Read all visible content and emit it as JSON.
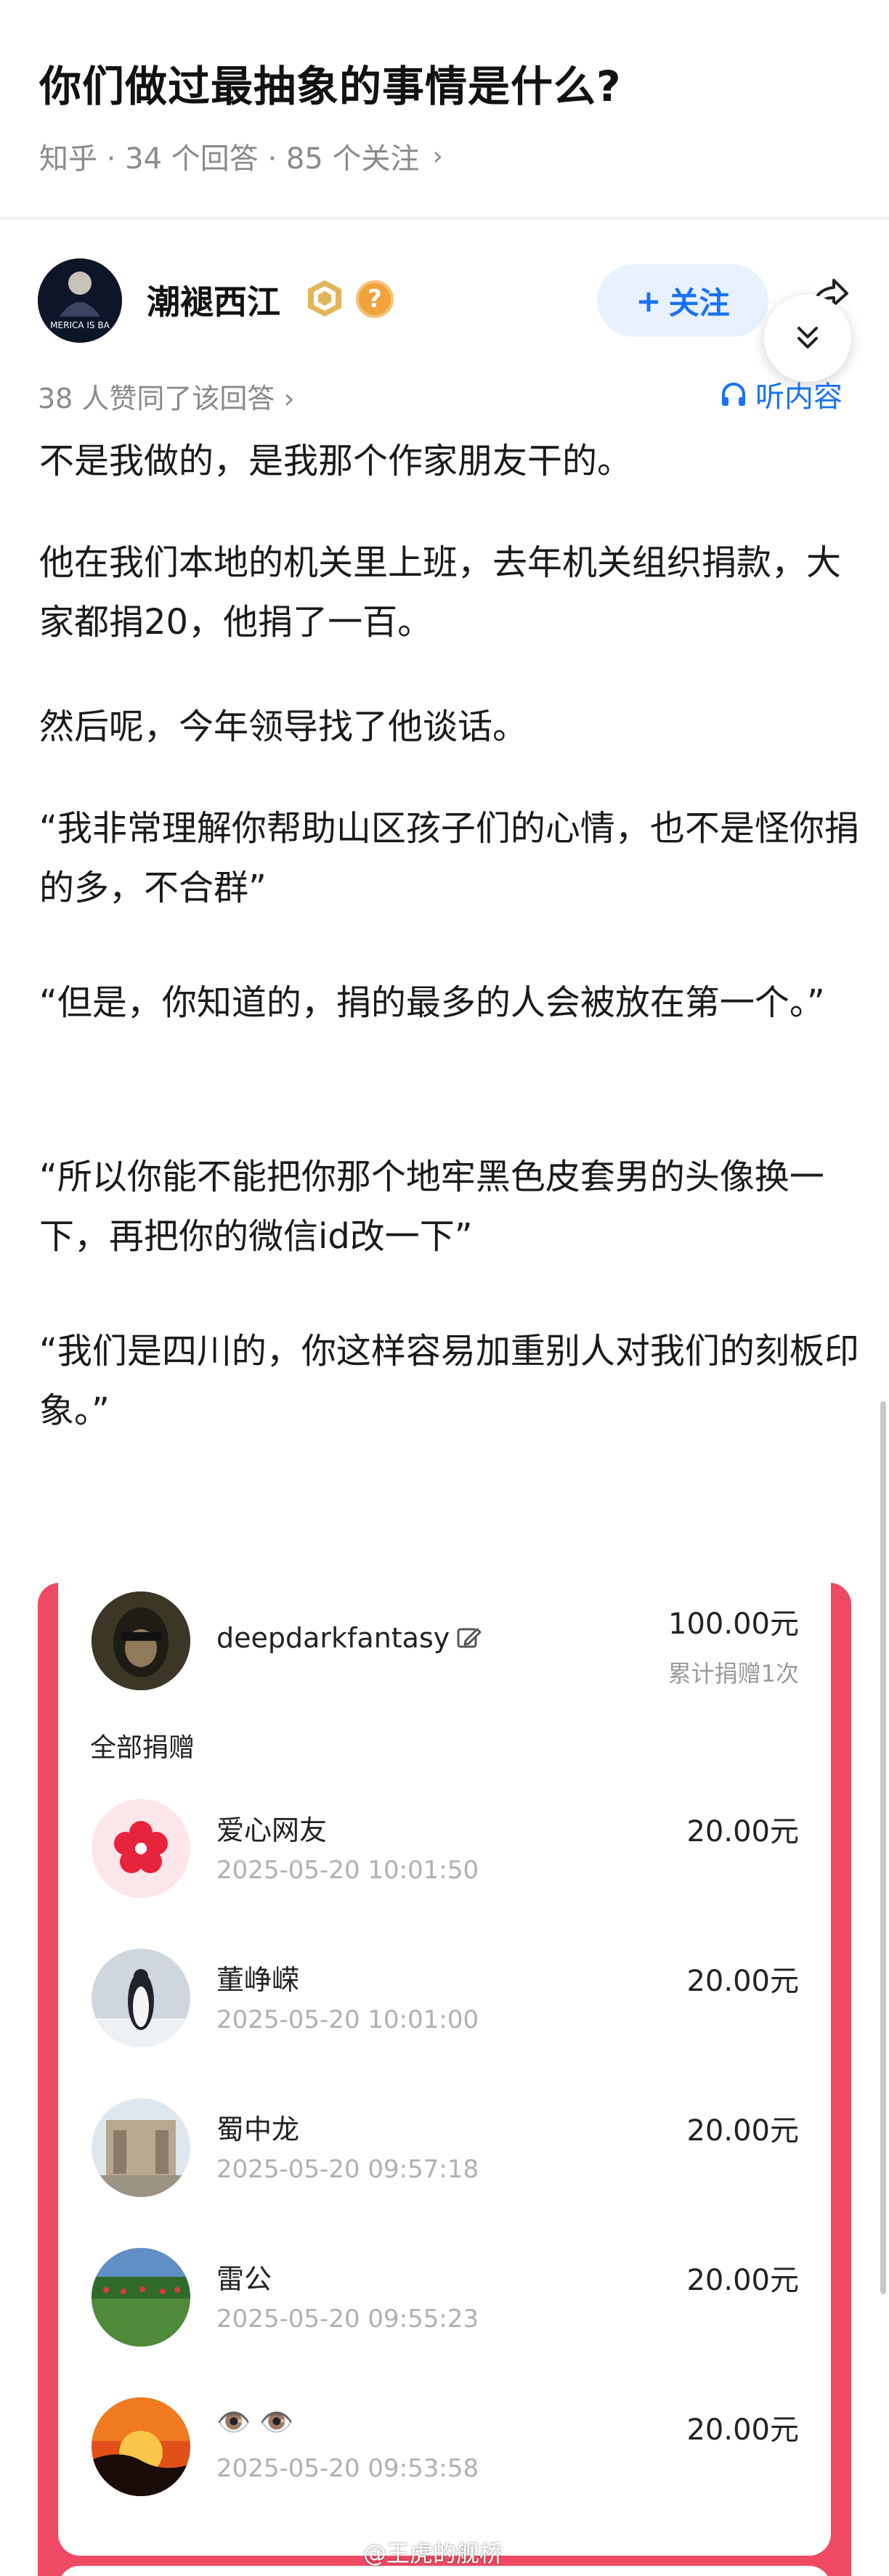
{
  "question": {
    "title": "你们做过最抽象的事情是什么?",
    "meta": "知乎 · 34 个回答 · 85 个关注",
    "chevron": "›"
  },
  "author": {
    "name": "潮褪西江",
    "badge_question": "?",
    "follow_label": "关注",
    "follow_plus": "+",
    "avatar_text": "MERICA IS BA"
  },
  "answer_meta": {
    "votes": "38 人赞同了该回答 ›",
    "listen_label": "听内容"
  },
  "answer": {
    "paragraphs": [
      "不是我做的，是我那个作家朋友干的。",
      "他在我们本地的机关里上班，去年机关组织捐款，大家都捐20，他捐了一百。",
      "然后呢，今年领导找了他谈话。",
      "“我非常理解你帮助山区孩子们的心情，也不是怪你捐的多，不合群”",
      "“但是，你知道的，捐的最多的人会被放在第一个。”",
      "“所以你能不能把你那个地牢黑色皮套男的头像换一下，再把你的微信id改一下”",
      "“我们是四川的，你这样容易加重别人对我们的刻板印象。”"
    ]
  },
  "donation": {
    "top_donor": {
      "name": "deepdarkfantasy",
      "amount": "100.00元",
      "sub": "累计捐赠1次"
    },
    "all_label": "全部捐赠",
    "rows": [
      {
        "name": "爱心网友",
        "time": "2025-05-20 10:01:50",
        "amount": "20.00元"
      },
      {
        "name": "董峥嵘",
        "time": "2025-05-20 10:01:00",
        "amount": "20.00元"
      },
      {
        "name": "蜀中龙",
        "time": "2025-05-20 09:57:18",
        "amount": "20.00元"
      },
      {
        "name": "雷公",
        "time": "2025-05-20 09:55:23",
        "amount": "20.00元"
      },
      {
        "name": "👁️ 👁️",
        "time": "2025-05-20 09:53:58",
        "amount": "20.00元"
      }
    ]
  },
  "watermark": "@王虎的舰桥",
  "colors": {
    "accent_blue": "#1772f6",
    "card_red": "#ee4a63",
    "meta_gray": "#8a8a8a"
  }
}
